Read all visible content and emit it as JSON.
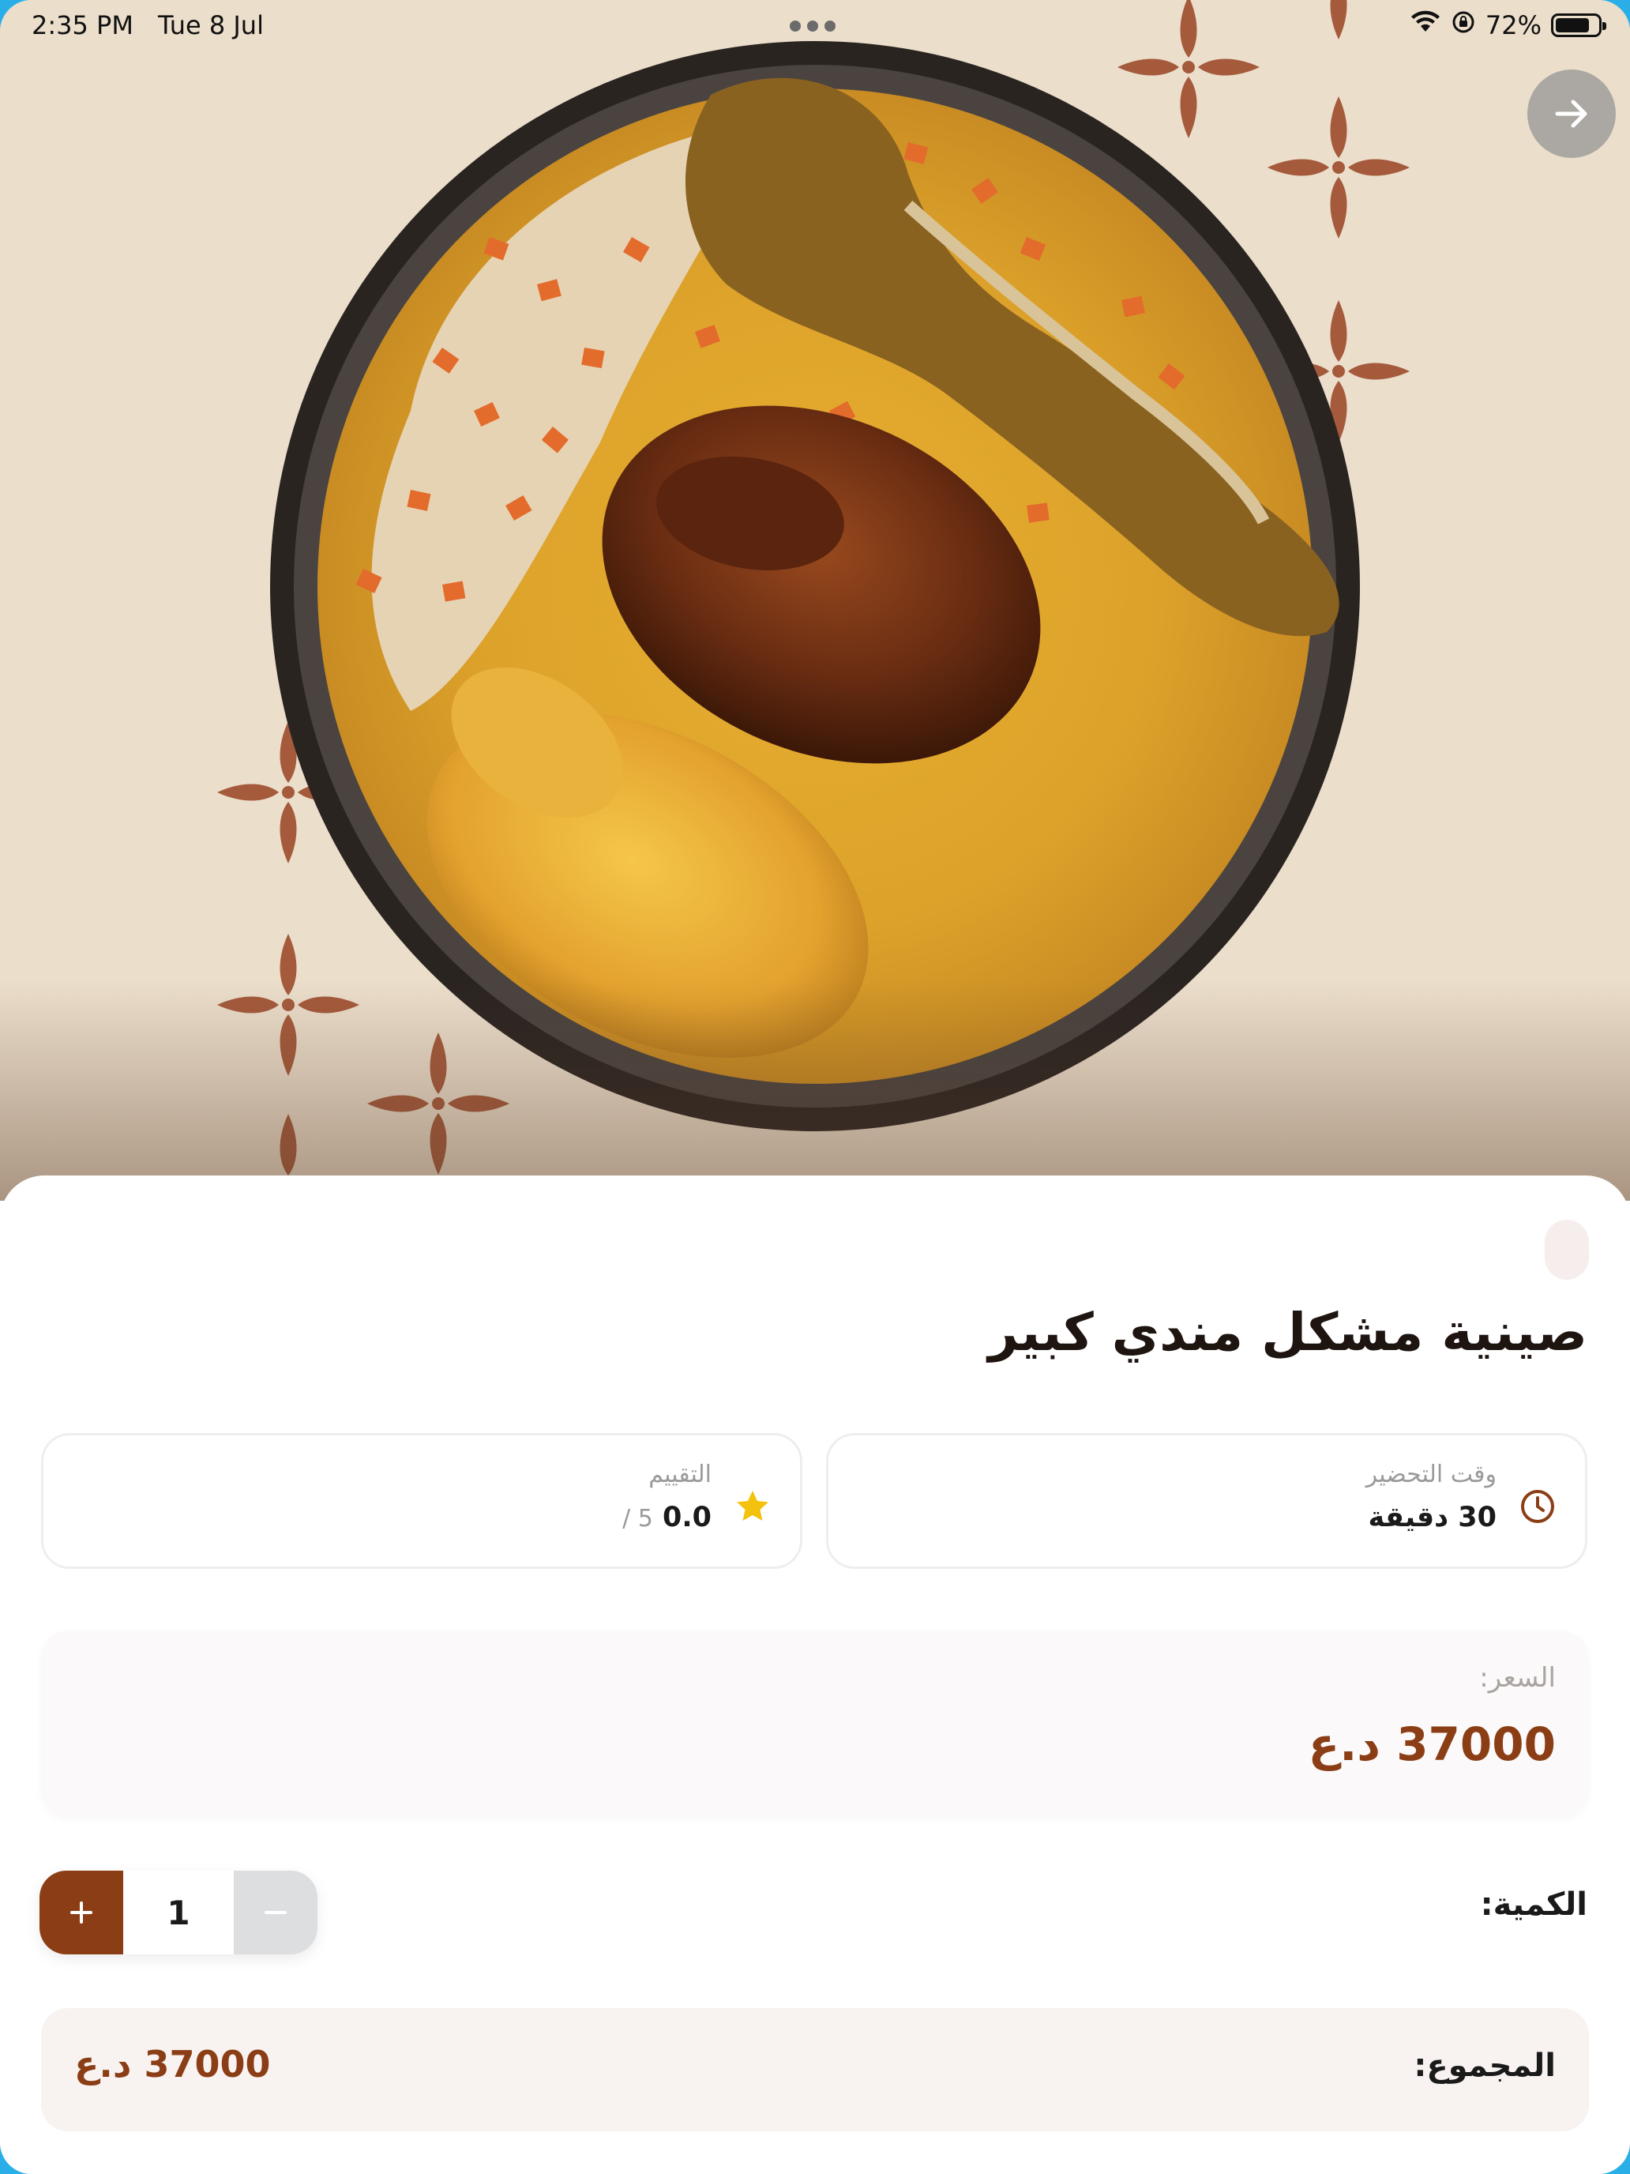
{
  "status_bar": {
    "time": "2:35 PM",
    "date": "Tue 8 Jul",
    "battery": "72%",
    "battery_level": 0.72,
    "icons": [
      "wifi-icon",
      "orientation-lock-icon",
      "battery-icon"
    ]
  },
  "colors": {
    "brand": "#8b3e16",
    "rating_star": "#f4c20d",
    "price_box_bg": "#fbf9f9",
    "total_box_bg": "#f8f3f1"
  },
  "hero": {
    "image": "mandi-mixed-platter-photo",
    "nav_icon": "arrow-right-icon"
  },
  "product": {
    "title": "صينية مشكل مندي كبير"
  },
  "prep_time": {
    "label": "وقت التحضير",
    "value": "30 دقيقة",
    "icon": "clock-icon"
  },
  "rating": {
    "label": "التقييم",
    "value": "0.0",
    "max": "/ 5",
    "icon": "star-icon"
  },
  "price": {
    "label": "السعر:",
    "value": "37000 د.ع"
  },
  "quantity": {
    "label": "الكمية:",
    "value": "1",
    "plus_icon": "plus-icon",
    "minus_icon": "minus-icon"
  },
  "total": {
    "label": "المجموع:",
    "value": "37000 د.ع"
  }
}
